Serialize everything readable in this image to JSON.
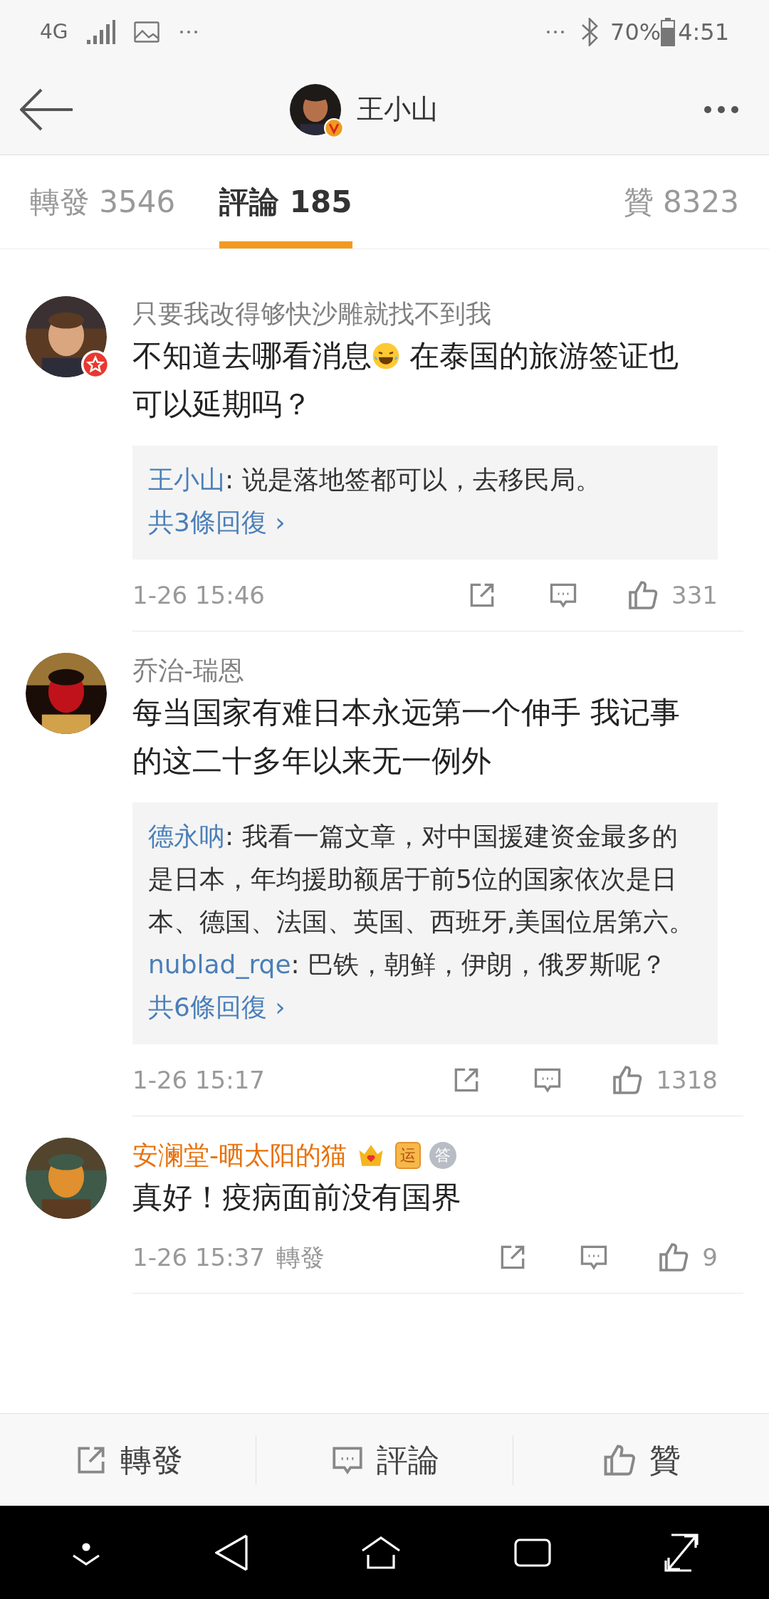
{
  "status_bar": {
    "network": "4G",
    "battery": "70%",
    "time": "4:51"
  },
  "header": {
    "title": "王小山",
    "verified": true
  },
  "tabs": [
    {
      "label": "轉發 3546",
      "selected": false
    },
    {
      "label": "評論 185",
      "selected": true
    },
    {
      "label": "贊 8323",
      "selected": false
    }
  ],
  "comments": [
    {
      "name": "只要我改得够快沙雕就找不到我",
      "color": "#808080",
      "avatar_badge": true,
      "body": [
        {
          "kind": "text",
          "text": "不知道去哪看消息"
        },
        {
          "kind": "emoji"
        },
        {
          "kind": "text",
          "text": " 在泰国的旅游签证也可以延期吗？"
        }
      ],
      "replies": [
        {
          "user": "王小山",
          "text": ": 说是落地签都可以，去移民局。"
        }
      ],
      "more": "共3條回復 ›",
      "time": "1-26 15:46",
      "likes": "331"
    },
    {
      "name": "乔治-瑞恩",
      "color": "#808080",
      "avatar_badge": false,
      "body": [
        {
          "kind": "text",
          "text": "每当国家有难日本永远第一个伸手 我记事的这二十多年以来无一例外"
        }
      ],
      "replies": [
        {
          "user": "德永呐",
          "text": ": 我看一篇文章，对中国援建资金最多的是日本，年均援助额居于前5位的国家依次是日本、德国、法国、英国、西班牙,美国位居第六。"
        },
        {
          "user": "nublad_rqe",
          "text": ": 巴铁，朝鲜，伊朗，俄罗斯呢？"
        }
      ],
      "more": "共6條回復 ›",
      "time": "1-26 15:17",
      "likes": "1318"
    },
    {
      "name": "安澜堂-晒太阳的猫",
      "color": "#e8710a",
      "avatar_badge": false,
      "badges": [
        {
          "kind": "crown"
        },
        {
          "kind": "tag",
          "text": "运"
        },
        {
          "kind": "medal",
          "text": "答"
        }
      ],
      "body": [
        {
          "kind": "text",
          "text": "真好！疫病面前没有国界"
        }
      ],
      "time": "1-26 15:37",
      "repost": "轉發",
      "likes": "9"
    }
  ],
  "actions": [
    {
      "kind": "repost",
      "label": "轉發"
    },
    {
      "kind": "comment",
      "label": "評論"
    },
    {
      "kind": "like",
      "label": "贊"
    }
  ]
}
